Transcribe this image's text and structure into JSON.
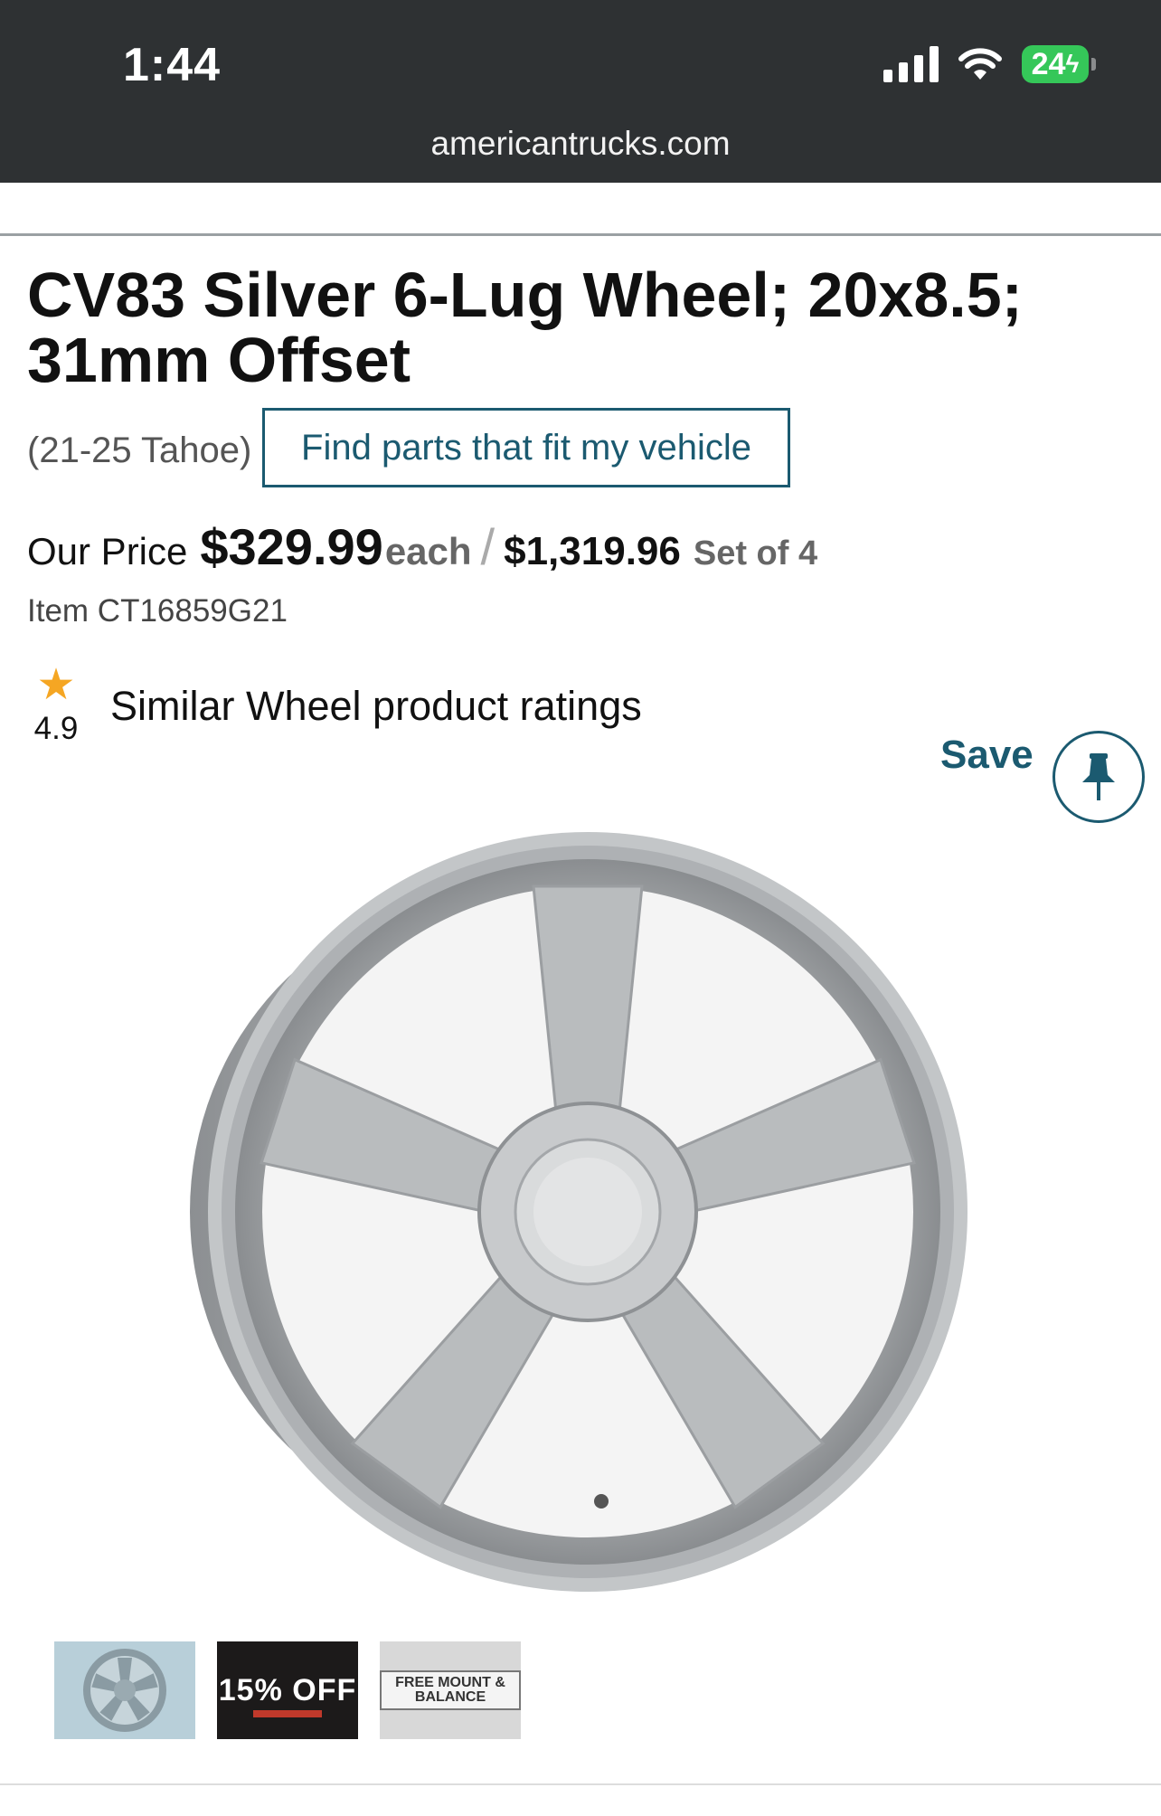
{
  "status_bar": {
    "time": "1:44",
    "battery": "24",
    "url": "americantrucks.com"
  },
  "product": {
    "title": "CV83 Silver 6-Lug Wheel; 20x8.5; 31mm Offset",
    "fitment": "(21-25 Tahoe)",
    "fit_button_label": "Find parts that fit my vehicle",
    "our_price_label": "Our Price",
    "price": "$329.99",
    "each_label": "each",
    "slash": "/",
    "set_price": "$1,319.96",
    "set_label": "Set of 4",
    "item_number": "Item CT16859G21",
    "rating_value": "4.9",
    "rating_label": "Similar Wheel product ratings",
    "save_label": "Save"
  },
  "thumbnails": [
    {
      "name": "wheel"
    },
    {
      "name": "promo",
      "text": "15% OFF"
    },
    {
      "name": "free-mount",
      "text": "FREE MOUNT & BALANCE"
    }
  ],
  "colors": {
    "brand": "#1b5a70",
    "star": "#f5a623",
    "status_bar": "#2e3133",
    "battery": "#35c759"
  }
}
